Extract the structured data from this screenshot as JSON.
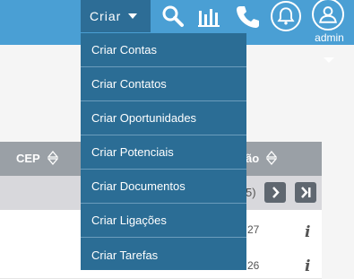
{
  "header": {
    "create_label": "Criar",
    "user_label": "admin"
  },
  "create_menu": {
    "items": [
      {
        "label": "Criar Contas"
      },
      {
        "label": "Criar Contatos"
      },
      {
        "label": "Criar Oportunidades"
      },
      {
        "label": "Criar Potenciais"
      },
      {
        "label": "Criar Documentos"
      },
      {
        "label": "Criar Ligações"
      },
      {
        "label": "Criar Tarefas"
      }
    ]
  },
  "table": {
    "columns": [
      "CEP",
      "ão"
    ],
    "pager_text": "5)",
    "rows": [
      {
        "date_fragment": "27"
      },
      {
        "date_fragment": "26"
      }
    ]
  },
  "colors": {
    "topbar": "#4a9fd4",
    "menu_bg": "#2b6d95",
    "header_row": "#9aa0a6"
  }
}
